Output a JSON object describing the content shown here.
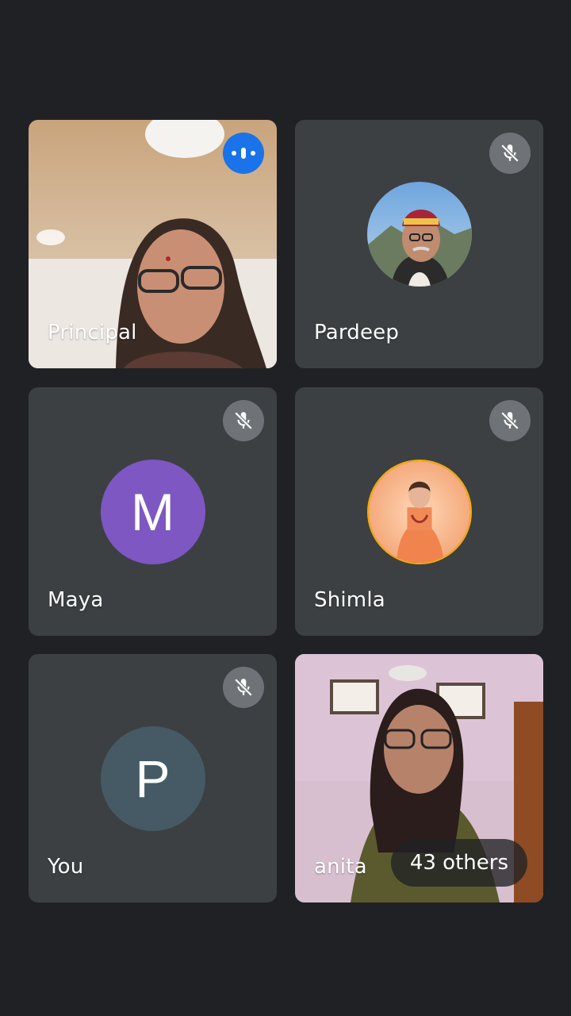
{
  "participants": [
    {
      "name": "Principal",
      "speaking": true,
      "video": true
    },
    {
      "name": "Pardeep",
      "muted": true,
      "avatar": "photo"
    },
    {
      "name": "Maya",
      "muted": true,
      "avatar_letter": "M",
      "avatar_color": "#7e57c2"
    },
    {
      "name": "Shimla",
      "muted": true,
      "avatar": "photo",
      "avatar_border": "#f9ab00"
    },
    {
      "name": "You",
      "muted": true,
      "avatar_letter": "P",
      "avatar_color": "#455a64"
    },
    {
      "name": "anita",
      "video": true
    }
  ],
  "others_chip": "43 others",
  "icons": {
    "speaking": "speaking-indicator-icon",
    "muted": "mic-off-icon"
  },
  "colors": {
    "background": "#202124",
    "tile": "#3c4043",
    "speaking": "#1a73e8",
    "mute_badge": "#6f7378"
  }
}
